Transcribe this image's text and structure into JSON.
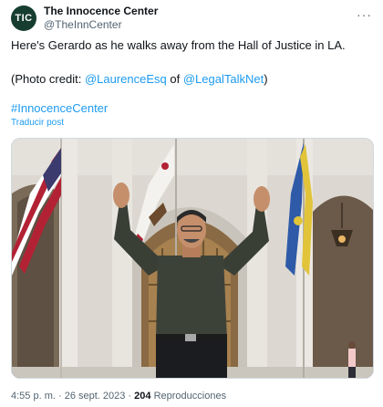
{
  "tweet": {
    "avatar_initials": "TIC",
    "avatar_color": "#163d30",
    "display_name": "The Innocence Center",
    "handle": "@TheInnCenter",
    "more_glyph": "···",
    "line1": "Here's Gerardo as he walks away from the Hall of Justice in LA.",
    "credit_prefix": "(Photo credit: ",
    "credit_link1": "@LaurenceEsq",
    "credit_mid": " of ",
    "credit_link2": "@LegalTalkNet",
    "credit_suffix": ")",
    "hashtag": "#InnocenceCenter",
    "translate": "Traducir post",
    "link_color": "#1d9bf0"
  },
  "meta": {
    "time": "4:55 p. m.",
    "separator": " · ",
    "date": "26 sept. 2023",
    "views_count": "204",
    "views_label": " Reproducciones"
  },
  "photo": {
    "subject": "man with raised arms in front of building with flags",
    "icons": [
      "us-flag",
      "california-flag",
      "la-county-flag",
      "lantern-icon"
    ]
  }
}
